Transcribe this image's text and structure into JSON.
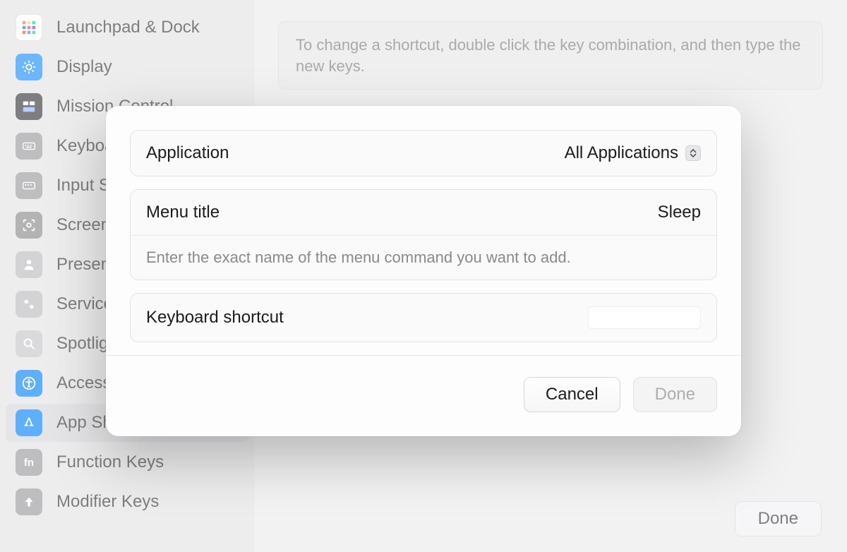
{
  "sidebar": {
    "items": [
      {
        "label": "Launchpad & Dock",
        "name": "sidebar-item-launchpad-dock",
        "icon": "grid"
      },
      {
        "label": "Display",
        "name": "sidebar-item-display",
        "icon": "sun"
      },
      {
        "label": "Mission Control",
        "name": "sidebar-item-mission-control",
        "icon": "mission"
      },
      {
        "label": "Keyboard",
        "name": "sidebar-item-keyboard",
        "icon": "keyboard"
      },
      {
        "label": "Input Sources",
        "name": "sidebar-item-input-sources",
        "icon": "keyboard"
      },
      {
        "label": "Screenshots",
        "name": "sidebar-item-screenshots",
        "icon": "camera"
      },
      {
        "label": "Presenter Overlay",
        "name": "sidebar-item-presenter",
        "icon": "person"
      },
      {
        "label": "Services",
        "name": "sidebar-item-services",
        "icon": "gear"
      },
      {
        "label": "Spotlight",
        "name": "sidebar-item-spotlight",
        "icon": "search"
      },
      {
        "label": "Accessibility",
        "name": "sidebar-item-accessibility",
        "icon": "accessibility"
      },
      {
        "label": "App Shortcuts",
        "name": "sidebar-item-app-shortcuts",
        "icon": "store",
        "selected": true
      },
      {
        "label": "Function Keys",
        "name": "sidebar-item-function-keys",
        "icon": "fn"
      },
      {
        "label": "Modifier Keys",
        "name": "sidebar-item-modifier-keys",
        "icon": "arrowup"
      }
    ]
  },
  "main": {
    "hint": "To change a shortcut, double click the key combination, and then type the new keys.",
    "expand_label": "All Applications",
    "done_label": "Done"
  },
  "sheet": {
    "application": {
      "label": "Application",
      "value": "All Applications"
    },
    "menu_title": {
      "label": "Menu title",
      "value": "Sleep",
      "hint": "Enter the exact name of the menu command you want to add."
    },
    "shortcut": {
      "label": "Keyboard shortcut",
      "value": ""
    },
    "cancel_label": "Cancel",
    "done_label": "Done"
  }
}
